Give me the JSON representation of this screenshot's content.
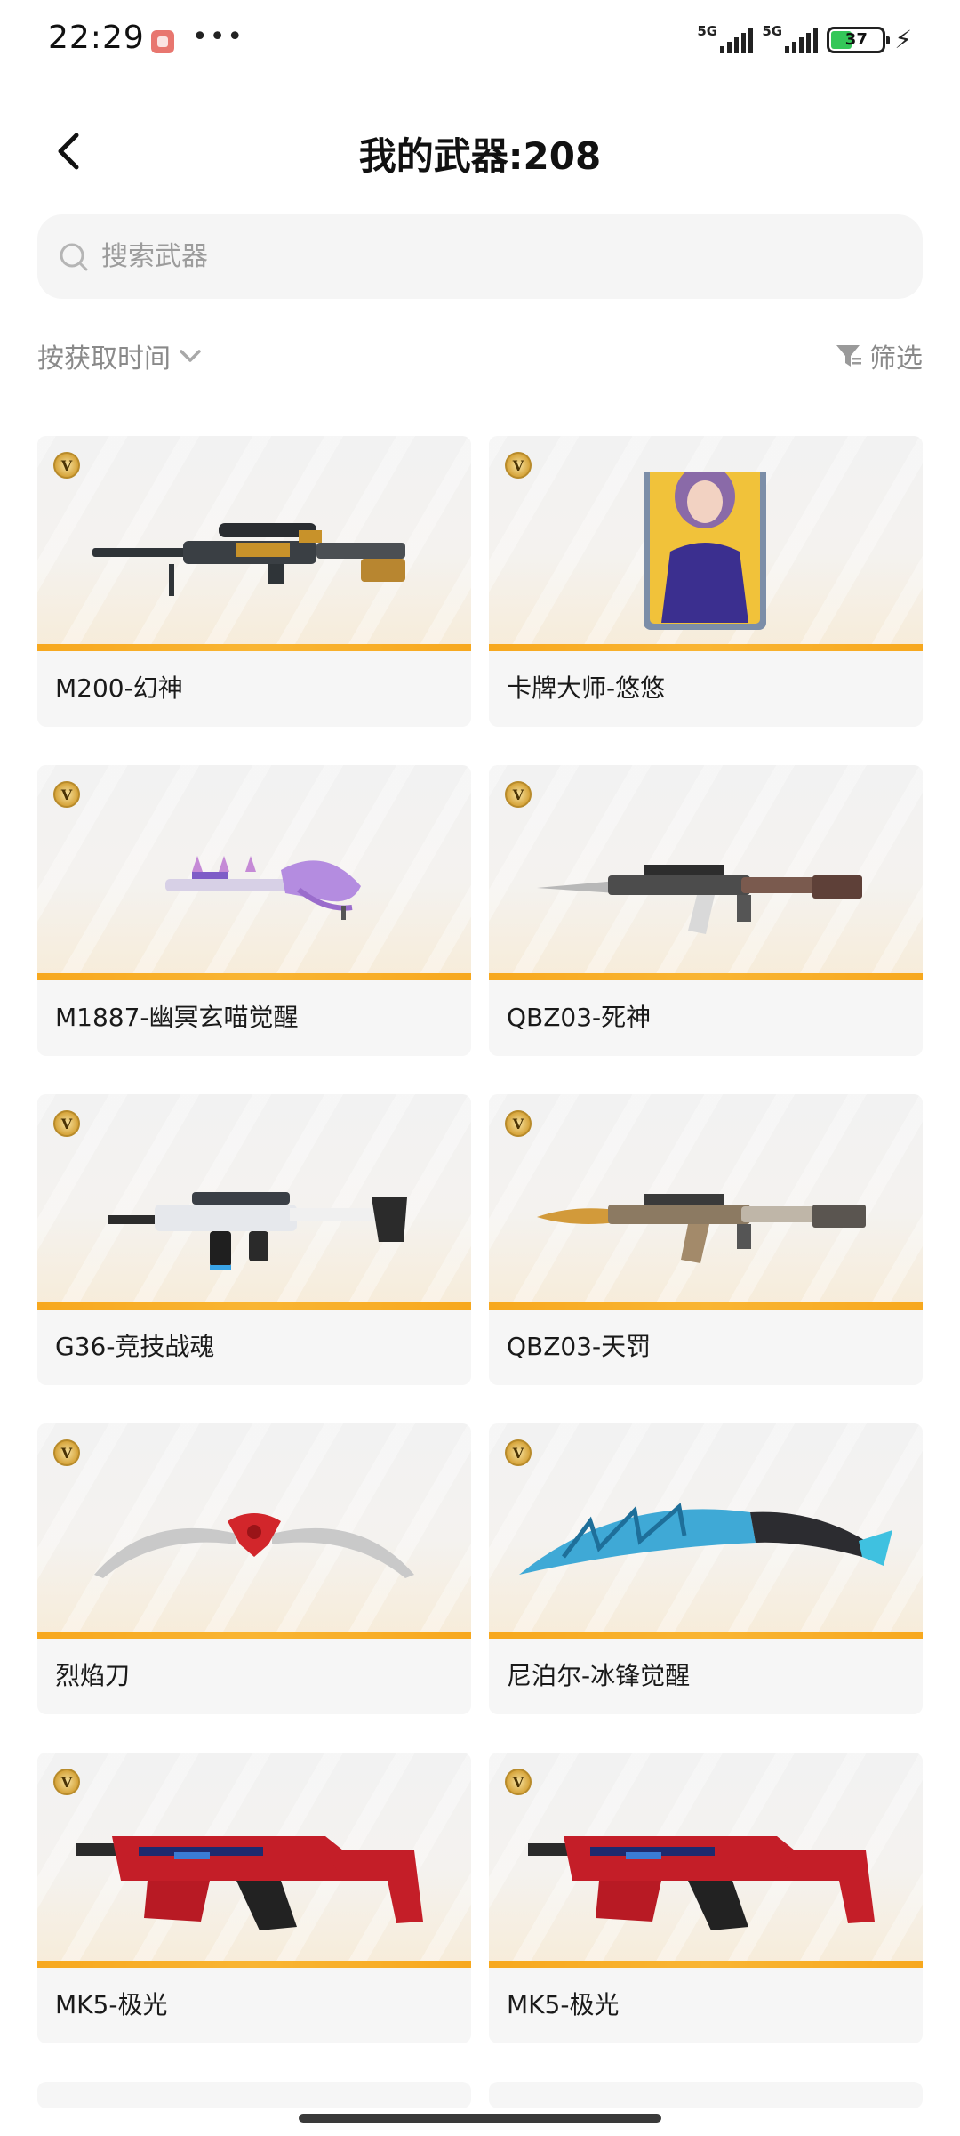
{
  "status_bar": {
    "time": "22:29",
    "network_1": "5G",
    "network_2": "5G",
    "battery": "37",
    "battery_level": 0.37
  },
  "header": {
    "title": "我的武器:208"
  },
  "search": {
    "placeholder": "搜索武器"
  },
  "sort": {
    "label": "按获取时间"
  },
  "filter": {
    "label": "筛选"
  },
  "items": [
    {
      "name": "M200-幻神",
      "art": "sniper-rifle-icon"
    },
    {
      "name": "卡牌大师-悠悠",
      "art": "character-card-icon"
    },
    {
      "name": "M1887-幽冥玄喵觉醒",
      "art": "shotgun-icon"
    },
    {
      "name": "QBZ03-死神",
      "art": "assault-rifle-icon"
    },
    {
      "name": "G36-竞技战魂",
      "art": "assault-rifle-icon"
    },
    {
      "name": "QBZ03-天罚",
      "art": "assault-rifle-icon"
    },
    {
      "name": "烈焰刀",
      "art": "twin-blade-icon"
    },
    {
      "name": "尼泊尔-冰锋觉醒",
      "art": "curved-blade-icon"
    },
    {
      "name": "MK5-极光",
      "art": "smg-icon"
    },
    {
      "name": "MK5-极光",
      "art": "smg-icon"
    }
  ],
  "badge_letter": "V",
  "colors": {
    "accent_bar": "#f7a81e",
    "badge_gold": "#d6a43a",
    "muted_text": "#8a8a8a",
    "search_bg": "#f5f5f5"
  }
}
